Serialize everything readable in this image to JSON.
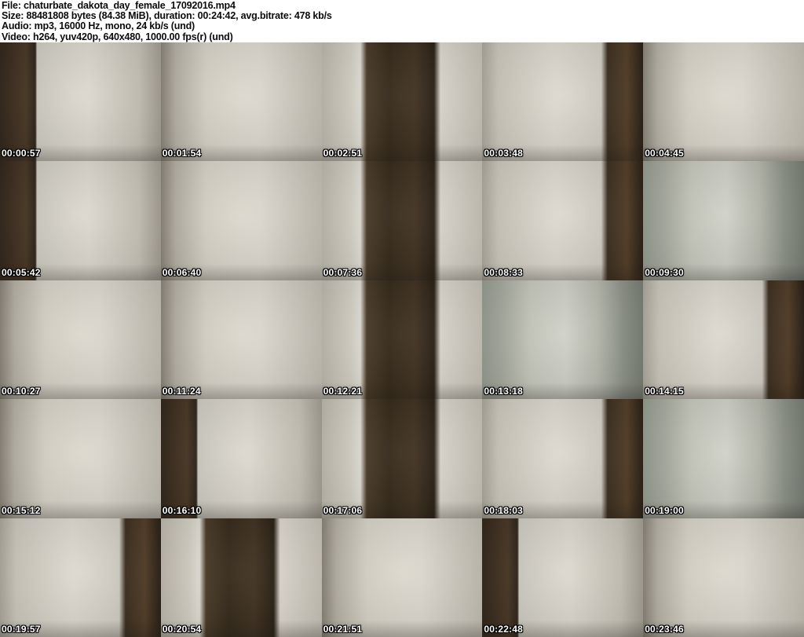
{
  "header": {
    "lines": [
      "File: chaturbate_dakota_day_female_17092016.mp4",
      "Size: 88481808 bytes (84.38 MiB), duration: 00:24:42, avg.bitrate: 478 kb/s",
      "Audio: mp3, 16000 Hz, mono, 24 kb/s (und)",
      "Video: h264, yuv420p, 640x480, 1000.00 fps(r) (und)"
    ]
  },
  "grid": {
    "columns": 5,
    "rows": 5,
    "thumbnails": [
      {
        "timestamp": "00:00:57"
      },
      {
        "timestamp": "00:01:54"
      },
      {
        "timestamp": "00:02:51"
      },
      {
        "timestamp": "00:03:48"
      },
      {
        "timestamp": "00:04:45"
      },
      {
        "timestamp": "00:05:42"
      },
      {
        "timestamp": "00:06:40"
      },
      {
        "timestamp": "00:07:36"
      },
      {
        "timestamp": "00:08:33"
      },
      {
        "timestamp": "00:09:30"
      },
      {
        "timestamp": "00:10:27"
      },
      {
        "timestamp": "00:11:24"
      },
      {
        "timestamp": "00:12:21"
      },
      {
        "timestamp": "00:13:18"
      },
      {
        "timestamp": "00:14:15"
      },
      {
        "timestamp": "00:15:12"
      },
      {
        "timestamp": "00:16:10"
      },
      {
        "timestamp": "00:17:06"
      },
      {
        "timestamp": "00:18:03"
      },
      {
        "timestamp": "00:19:00"
      },
      {
        "timestamp": "00:19:57"
      },
      {
        "timestamp": "00:20:54"
      },
      {
        "timestamp": "00:21:51"
      },
      {
        "timestamp": "00:22:48"
      },
      {
        "timestamp": "00:23:46"
      }
    ]
  },
  "colors": {
    "page_background": "#ffffff",
    "header_text": "#0b0b0b",
    "timestamp_text": "#ffffff",
    "timestamp_outline": "#000000",
    "wall_light": "#ddd9cf",
    "wall_grey_green": "#9aa095",
    "door_dark_brown": "#3c2e1f"
  }
}
